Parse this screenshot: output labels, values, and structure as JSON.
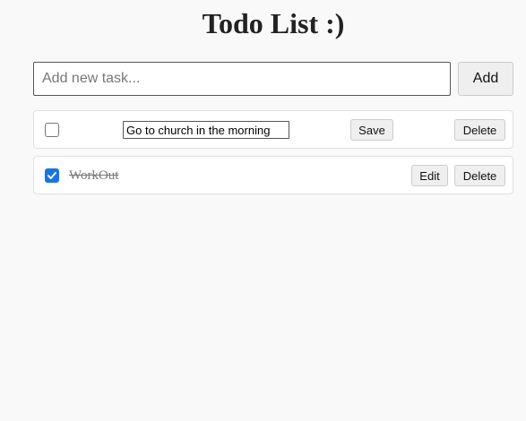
{
  "header": {
    "title": "Todo List :)"
  },
  "add_form": {
    "placeholder": "Add new task...",
    "value": "",
    "add_label": "Add"
  },
  "todos": [
    {
      "text": "Go to church in the morning",
      "completed": false,
      "editing": true,
      "primary_action_label": "Save",
      "delete_label": "Delete"
    },
    {
      "text": "WorkOut",
      "completed": true,
      "editing": false,
      "primary_action_label": "Edit",
      "delete_label": "Delete"
    }
  ],
  "colors": {
    "checkbox_checked": "#1a73e8",
    "background": "#f9f9f9"
  }
}
